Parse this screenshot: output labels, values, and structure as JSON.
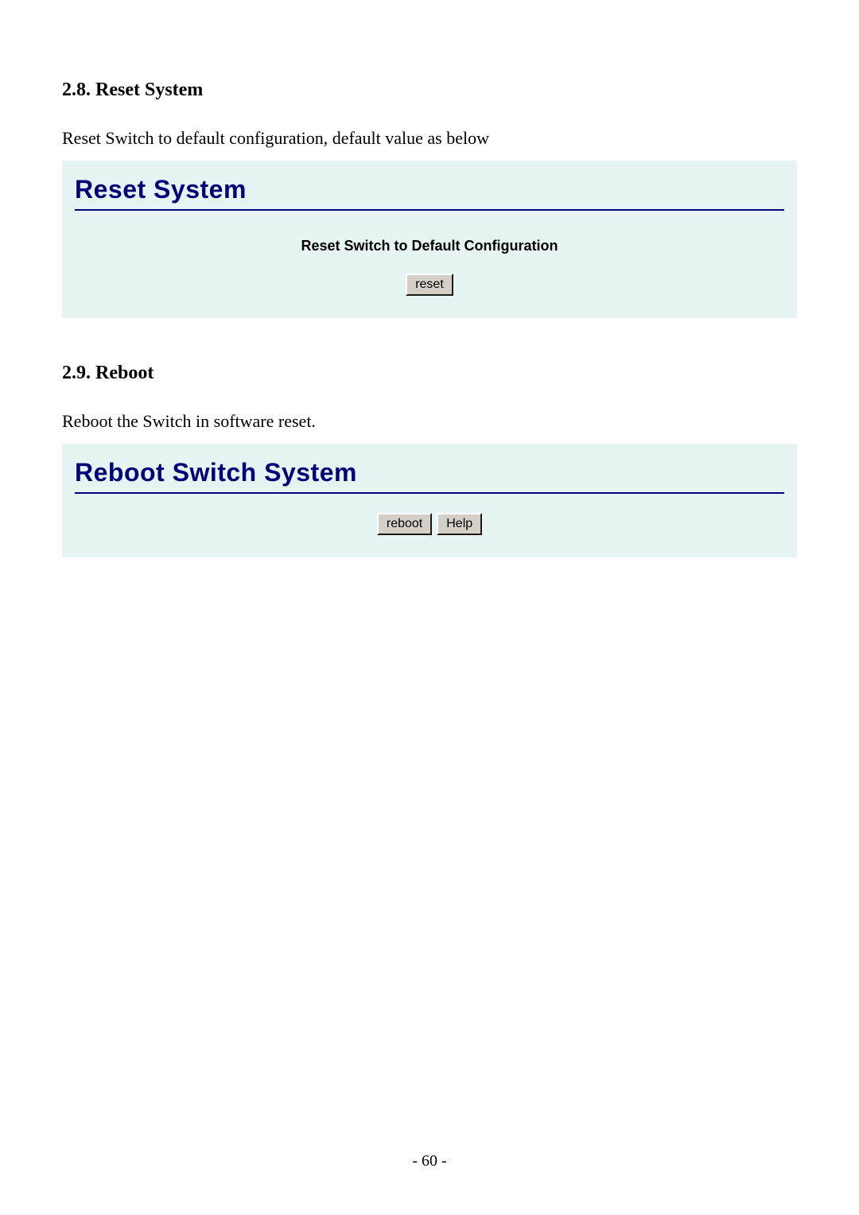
{
  "section1": {
    "heading": "2.8. Reset System",
    "body": "Reset Switch to default configuration, default value as below",
    "panel": {
      "title": "Reset System",
      "subheading": "Reset Switch to Default Configuration",
      "buttons": {
        "reset": "reset"
      }
    }
  },
  "section2": {
    "heading": "2.9. Reboot",
    "body": "Reboot the Switch in software reset.",
    "panel": {
      "title": "Reboot Switch System",
      "buttons": {
        "reboot": "reboot",
        "help": "Help"
      }
    }
  },
  "page_number": "- 60 -"
}
